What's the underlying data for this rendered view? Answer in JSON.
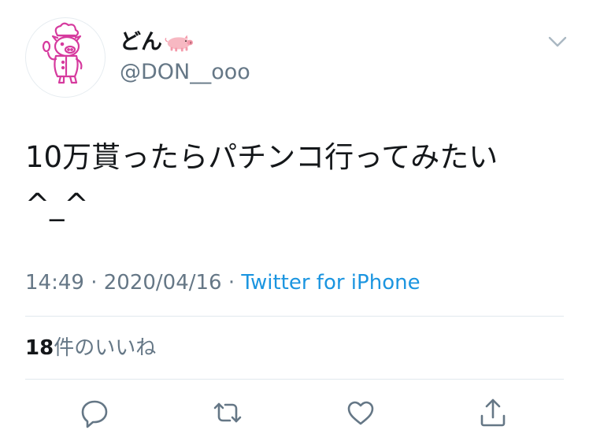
{
  "user": {
    "display_name": "どん",
    "handle": "@DON__ooo",
    "avatar_icon": "pig-chef-avatar",
    "name_emoji_icon": "pig-emoji"
  },
  "tweet": {
    "text": "10万貰ったらパチンコ行ってみたい\n^_^",
    "time": "14:49",
    "separator1": " · ",
    "date": "2020/04/16",
    "separator2": " · ",
    "source": "Twitter for iPhone"
  },
  "stats": {
    "likes_count": "18",
    "likes_label": "件のいいね"
  },
  "actions": {
    "reply_icon": "reply-icon",
    "retweet_icon": "retweet-icon",
    "like_icon": "heart-icon",
    "share_icon": "share-icon"
  },
  "colors": {
    "text": "#14171a",
    "secondary": "#657786",
    "link": "#1b95e0",
    "divider": "#e1e8ed",
    "avatar_accent": "#d63a9e"
  }
}
